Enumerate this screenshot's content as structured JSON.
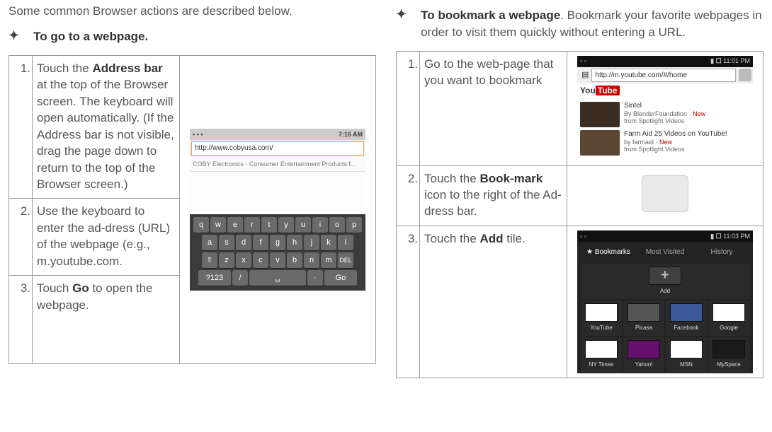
{
  "intro": "Some common Browser actions are described below.",
  "left": {
    "heading": "To go to a webpage.",
    "step1": {
      "num": "1.",
      "text_before": "Touch the ",
      "bold": "Address bar",
      "text_after": " at the top of the Browser screen. The keyboard will open automatically. (If the Address bar is not visible, drag the page down to return to the top of the Browser screen.)"
    },
    "step2": {
      "num": "2.",
      "text": "Use the keyboard to enter the ad-dress (URL) of the webpage (e.g., m.youtube.com."
    },
    "step3": {
      "num": "3.",
      "text_before": "Touch ",
      "bold": "Go",
      "text_after": " to open the webpage."
    },
    "shot": {
      "time": "7:16 AM",
      "url": "http://www.cobyusa.com/",
      "sub": "COBY Electronics - Consumer Entertainment Products f...",
      "kb_row1": [
        "q",
        "w",
        "e",
        "r",
        "t",
        "y",
        "u",
        "i",
        "o",
        "p"
      ],
      "kb_row2": [
        "a",
        "s",
        "d",
        "f",
        "g",
        "h",
        "j",
        "k",
        "l"
      ],
      "kb_row3_shift": "⇧",
      "kb_row3": [
        "z",
        "x",
        "c",
        "v",
        "b",
        "n",
        "m"
      ],
      "kb_row3_del": "DEL",
      "kb_row4": [
        "?123",
        "/",
        "",
        "·",
        "Go"
      ]
    }
  },
  "right": {
    "heading_bold": "To bookmark a webpage",
    "heading_rest": ". Bookmark your favorite webpages in order to visit them quickly without entering a URL.",
    "step1": {
      "num": "1.",
      "text": "Go to the web-page that you want to bookmark"
    },
    "step2": {
      "num": "2.",
      "text_before": "Touch the ",
      "bold": "Book-mark",
      "text_after": " icon to the right of the Ad-dress bar."
    },
    "step3": {
      "num": "3.",
      "text_before": "Touch the ",
      "bold": "Add",
      "text_after": " tile."
    },
    "shot1": {
      "time": "11:01 PM",
      "url": "http://m.youtube.com/#/home",
      "logo_you": "You",
      "logo_tube": "Tube",
      "vid1_title": "Sintel",
      "vid1_sub": "By BlenderFoundation",
      "vid1_new": "New",
      "vid1_src": "from Spotlight Videos",
      "vid2_title": "Farm Aid 25 Videos on YouTube!",
      "vid2_sub": "by farmaid",
      "vid2_new": "New",
      "vid2_src": "from Spotlight Videos"
    },
    "shot3": {
      "time": "11:03 PM",
      "tab1": "Bookmarks",
      "tab2": "Most Visited",
      "tab3": "History",
      "tiles_row1": [
        "Add",
        "YouTube",
        "Picasa",
        "Facebook",
        "Google"
      ],
      "tiles_row2": [
        "NY Times",
        "Yahoo!",
        "MSN",
        "MySpace"
      ]
    }
  }
}
